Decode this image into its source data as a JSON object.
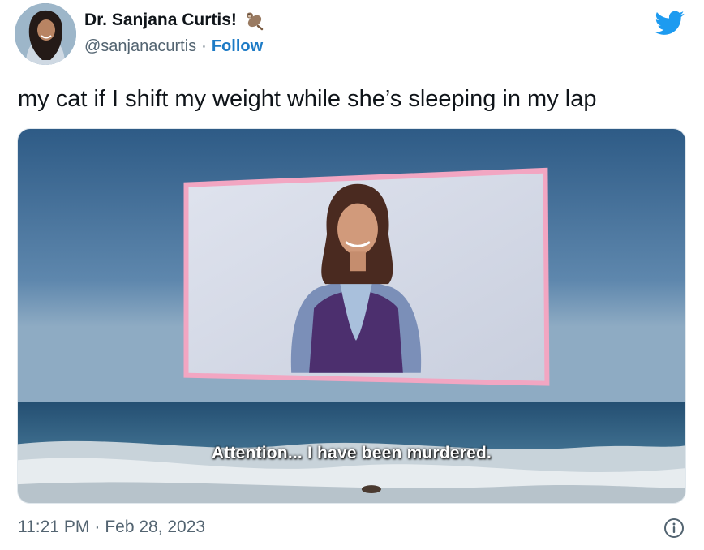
{
  "author": {
    "display_name": "Dr. Sanjana Curtis!",
    "handle": "@sanjanacurtis",
    "separator": "·",
    "follow_label": "Follow",
    "badge_icon": "otter-emoji-icon"
  },
  "platform_icon": "twitter-bird-icon",
  "tweet": {
    "text": "my cat if I shift my weight while she’s sleeping in my lap"
  },
  "media": {
    "subtitle": "Attention... I have been murdered."
  },
  "footer": {
    "time": "11:21 PM",
    "separator": "·",
    "date": "Feb 28, 2023",
    "info_icon": "info-icon"
  },
  "colors": {
    "link_blue": "#1d7bc6",
    "twitter_blue": "#1d9bf0",
    "muted": "#536471"
  }
}
